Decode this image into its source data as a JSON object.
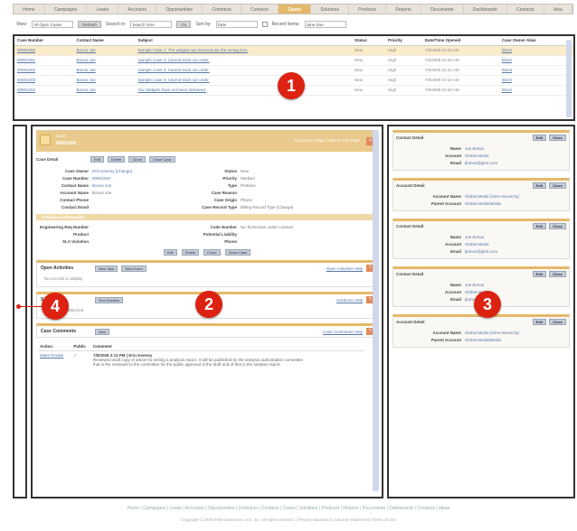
{
  "tabs": [
    "Home",
    "Campaigns",
    "Leads",
    "Accounts",
    "Opportunities",
    "Contracts",
    "Contacts",
    "Cases",
    "Solutions",
    "Products",
    "Reports",
    "Documents",
    "Dashboards",
    "Contacts",
    "Idea"
  ],
  "active_tab_index": 7,
  "toolbar": {
    "view_label": "View:",
    "view_value": "All Open Cases",
    "refresh_button": "Refresh",
    "search_label": "Search in:",
    "search_value": "Search here",
    "go_button": "Go",
    "sort_label": "Sort by:",
    "sort_value": "Date",
    "recent_label": "Recent Items:",
    "recent_value": "Jane Doe"
  },
  "list": {
    "columns": [
      "Case Number",
      "Contact Name",
      "Subject",
      "Status",
      "Priority",
      "Date/Time Opened",
      "Case Owner Alias"
    ],
    "rows": [
      [
        "00001000",
        "Bonus Joe",
        "Sample Case 1: The widgets we received are the wrong size.",
        "New",
        "High",
        "7/6/2009 10:42 AM",
        "hbest"
      ],
      [
        "00001001",
        "Bonus Joe",
        "Sample Case 2: Cannot track our order.",
        "New",
        "High",
        "7/6/2009 10:42 AM",
        "hbest"
      ],
      [
        "00001002",
        "Bonus Joe",
        "Sample Case 3: Cannot track our order.",
        "New",
        "High",
        "7/6/2009 10:42 AM",
        "hbest"
      ],
      [
        "00001003",
        "Bonus Joe",
        "Sample Case 3: Cannot track our order.",
        "New",
        "High",
        "7/6/2009 10:42 AM",
        "hbest"
      ],
      [
        "00001004",
        "Bonus Joe",
        "Our Widgets have not been delivered.",
        "New",
        "High",
        "7/6/2009 10:42 AM",
        "hbest"
      ]
    ]
  },
  "detail": {
    "header_title": "Case",
    "header_name": "00001000",
    "header_links": "Customize Page | Help for this Page",
    "section_label": "Case Detail",
    "buttons_top": [
      "Edit",
      "Delete",
      "Clone",
      "Close Case"
    ],
    "fields": [
      [
        "Case Owner",
        "Erin Keeney [Change]",
        "Status",
        "New"
      ],
      [
        "Case Number",
        "00001000",
        "Priority",
        "Medium"
      ],
      [
        "Contact Name",
        "Bonus Joe",
        "Type",
        "Problem"
      ],
      [
        "Account Name",
        "Bonus Joe",
        "Case Reason",
        ""
      ],
      [
        "Contact Phone",
        "",
        "Case Origin",
        "Phone"
      ],
      [
        "Contact Email",
        "",
        "Case Record Type",
        "Billing Record Type [Change]"
      ]
    ],
    "band_label": "Additional Information",
    "fields2": [
      [
        "Engineering Req Number",
        "",
        "Code Number",
        "No Technician under contract"
      ],
      [
        "Product",
        "",
        "Potential Liability",
        ""
      ],
      [
        "SLA Violation",
        "",
        "Phone",
        ""
      ]
    ],
    "buttons_bottom": [
      "Edit",
      "Delete",
      "Clone",
      "Close Case"
    ]
  },
  "related": [
    {
      "title": "Open Activities",
      "buttons": [
        "New Task",
        "New Event"
      ],
      "help": "Open Activities Help",
      "body": "No records to display"
    },
    {
      "title": "Solutions",
      "buttons": [
        "Find Solution"
      ],
      "help": "Solutions Help",
      "body": "No solutions attached"
    },
    {
      "title": "Case Comments",
      "buttons": [
        "New"
      ],
      "help": "Case Comments Help",
      "body": ""
    }
  ],
  "comments": {
    "columns": [
      "Action",
      "Public",
      "Comment"
    ],
    "row": {
      "action": "Make Private",
      "public": "✓",
      "author": "7/6/2009 3:11 PM | Erin Keeney",
      "text": "Reviewed draft copy of article for writing a analysis report. It will be published by the analysis authoritative committee that is the reviewed to the committee for the public approval of the draft and of that is the analysis report."
    }
  },
  "mini_panels": [
    {
      "title": "Contact Detail",
      "buttons": [
        "Edit",
        "Close"
      ],
      "rows": [
        [
          "Name",
          "Joe Bonus"
        ],
        [
          "Account",
          "Global Media"
        ],
        [
          "Email",
          "jbonus@glmt.com"
        ]
      ]
    },
    {
      "title": "Account Detail",
      "buttons": [
        "Edit",
        "Close"
      ],
      "rows": [
        [
          "Account Name",
          "Global Media [View Hierarchy]"
        ],
        [
          "Parent Account",
          "Global Media/Media"
        ]
      ]
    },
    {
      "title": "Contact Detail",
      "buttons": [
        "Edit",
        "Close"
      ],
      "rows": [
        [
          "Name",
          "Joe Bonus"
        ],
        [
          "Account",
          "Global Media"
        ],
        [
          "Email",
          "jbonus@glmt.com"
        ]
      ]
    },
    {
      "title": "Contact Detail",
      "buttons": [
        "Edit",
        "Close"
      ],
      "rows": [
        [
          "Name",
          "Joe Bonus"
        ],
        [
          "Account",
          "Global Media"
        ],
        [
          "Email",
          "jbonus@glmt.com"
        ]
      ]
    },
    {
      "title": "Account Detail",
      "buttons": [
        "Edit",
        "Close"
      ],
      "rows": [
        [
          "Account Name",
          "Global Media [View Hierarchy]"
        ],
        [
          "Parent Account",
          "Global Media/Media"
        ]
      ]
    }
  ],
  "markers": [
    "1",
    "2",
    "3",
    "4"
  ],
  "footer": {
    "links": "Home | Campaigns | Leads | Accounts | Opportunities | Contracts | Contacts | Cases | Solutions | Products | Reports | Documents | Dashboards | Contacts | Ideas",
    "copyright": "Copyright © 2000-2009 salesforce.com, inc. All rights reserved. | Privacy Statement | Security Statement | Terms of Use"
  },
  "colors": {
    "accent": "#e5b96b",
    "marker": "#dd2212",
    "link": "#5577aa"
  }
}
